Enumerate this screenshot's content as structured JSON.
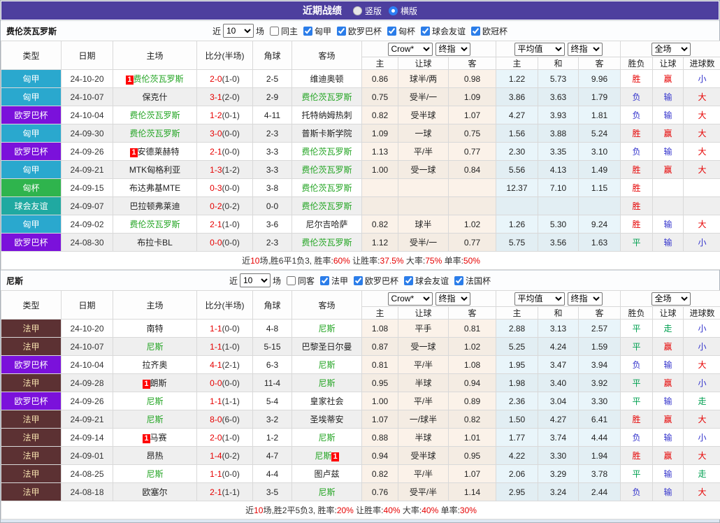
{
  "page": {
    "title": "近期战绩",
    "layout_options": [
      {
        "label": "竖版",
        "selected": false
      },
      {
        "label": "横版",
        "selected": true
      }
    ]
  },
  "table_header": {
    "type": "类型",
    "date": "日期",
    "home": "主场",
    "score": "比分(半场)",
    "corner": "角球",
    "away": "客场",
    "group1_select1": "Crow*",
    "group1_select2": "终指",
    "group2_select1": "平均值",
    "group2_select2": "终指",
    "group3_select1": "全场",
    "group1_cols": [
      "主",
      "让球",
      "客"
    ],
    "group2_cols": [
      "主",
      "和",
      "客"
    ],
    "group3_cols": [
      "胜负",
      "让球",
      "进球数"
    ]
  },
  "colors": {
    "accent": "#4D3F9E",
    "team_highlight": "#22A422",
    "score_red": "#E60000",
    "badge_bg": "#FF0000",
    "type_badges": {
      "匈甲": {
        "bg": "#2AA8CE",
        "fg": "#FFFFFF"
      },
      "欧罗巴杯": {
        "bg": "#7B11DB",
        "fg": "#FFFFFF"
      },
      "匈杯": {
        "bg": "#2FB44D",
        "fg": "#FFFFFF"
      },
      "球会友谊": {
        "bg": "#20A9A1",
        "fg": "#FFFFFF"
      },
      "法甲": {
        "bg": "#5C3133",
        "fg": "#F4DFAD"
      }
    },
    "result": {
      "胜": "#E60000",
      "平": "#00A050",
      "负": "#3333CC",
      "赢": "#E60000",
      "输": "#3333CC",
      "走": "#00A050",
      "大": "#E60000",
      "小": "#3333CC"
    }
  },
  "sections": [
    {
      "team": "费伦茨瓦罗斯",
      "filter": {
        "prefix": "近",
        "count": "10",
        "suffix": "场",
        "same": {
          "label": "同主",
          "checked": false
        },
        "leagues": [
          {
            "label": "匈甲",
            "checked": true
          },
          {
            "label": "欧罗巴杯",
            "checked": true
          },
          {
            "label": "匈杯",
            "checked": true
          },
          {
            "label": "球会友谊",
            "checked": true
          },
          {
            "label": "欧冠杯",
            "checked": true
          }
        ]
      },
      "rows": [
        {
          "type": "匈甲",
          "date": "24-10-20",
          "home": {
            "name": "费伦茨瓦罗斯",
            "green": true,
            "badge": "1"
          },
          "score": "2-0",
          "half": "(1-0)",
          "corner": "2-5",
          "away": {
            "name": "维迪奥顿"
          },
          "crown": [
            "0.86",
            "球半/两",
            "0.98"
          ],
          "avg": [
            "1.22",
            "5.73",
            "9.96"
          ],
          "result": [
            "胜",
            "赢",
            "小"
          ]
        },
        {
          "type": "匈甲",
          "date": "24-10-07",
          "home": {
            "name": "保克什"
          },
          "score": "3-1",
          "half": "(2-0)",
          "corner": "2-9",
          "away": {
            "name": "费伦茨瓦罗斯",
            "green": true
          },
          "crown": [
            "0.75",
            "受半/一",
            "1.09"
          ],
          "avg": [
            "3.86",
            "3.63",
            "1.79"
          ],
          "result": [
            "负",
            "输",
            "大"
          ]
        },
        {
          "type": "欧罗巴杯",
          "date": "24-10-04",
          "home": {
            "name": "费伦茨瓦罗斯",
            "green": true
          },
          "score": "1-2",
          "half": "(0-1)",
          "corner": "4-11",
          "away": {
            "name": "托特纳姆热刺"
          },
          "crown": [
            "0.82",
            "受半球",
            "1.07"
          ],
          "avg": [
            "4.27",
            "3.93",
            "1.81"
          ],
          "result": [
            "负",
            "输",
            "大"
          ]
        },
        {
          "type": "匈甲",
          "date": "24-09-30",
          "home": {
            "name": "费伦茨瓦罗斯",
            "green": true
          },
          "score": "3-0",
          "half": "(0-0)",
          "corner": "2-3",
          "away": {
            "name": "普斯卡斯学院"
          },
          "crown": [
            "1.09",
            "一球",
            "0.75"
          ],
          "avg": [
            "1.56",
            "3.88",
            "5.24"
          ],
          "result": [
            "胜",
            "赢",
            "大"
          ]
        },
        {
          "type": "欧罗巴杯",
          "date": "24-09-26",
          "home": {
            "name": "安德莱赫特",
            "badge": "1"
          },
          "score": "2-1",
          "half": "(0-0)",
          "corner": "3-3",
          "away": {
            "name": "费伦茨瓦罗斯",
            "green": true
          },
          "crown": [
            "1.13",
            "平/半",
            "0.77"
          ],
          "avg": [
            "2.30",
            "3.35",
            "3.10"
          ],
          "result": [
            "负",
            "输",
            "大"
          ]
        },
        {
          "type": "匈甲",
          "date": "24-09-21",
          "home": {
            "name": "MTK匈格利亚"
          },
          "score": "1-3",
          "half": "(1-2)",
          "corner": "3-3",
          "away": {
            "name": "费伦茨瓦罗斯",
            "green": true
          },
          "crown": [
            "1.00",
            "受一球",
            "0.84"
          ],
          "avg": [
            "5.56",
            "4.13",
            "1.49"
          ],
          "result": [
            "胜",
            "赢",
            "大"
          ]
        },
        {
          "type": "匈杯",
          "date": "24-09-15",
          "home": {
            "name": "布达弗基MTE"
          },
          "score": "0-3",
          "half": "(0-0)",
          "corner": "3-8",
          "away": {
            "name": "费伦茨瓦罗斯",
            "green": true
          },
          "crown": [
            "",
            "",
            ""
          ],
          "avg": [
            "12.37",
            "7.10",
            "1.15"
          ],
          "result": [
            "胜",
            "",
            ""
          ]
        },
        {
          "type": "球会友谊",
          "date": "24-09-07",
          "home": {
            "name": "巴拉顿弗莱迪"
          },
          "score": "0-2",
          "half": "(0-2)",
          "corner": "0-0",
          "away": {
            "name": "费伦茨瓦罗斯",
            "green": true
          },
          "crown": [
            "",
            "",
            ""
          ],
          "avg": [
            "",
            "",
            ""
          ],
          "result": [
            "胜",
            "",
            ""
          ]
        },
        {
          "type": "匈甲",
          "date": "24-09-02",
          "home": {
            "name": "费伦茨瓦罗斯",
            "green": true
          },
          "score": "2-1",
          "half": "(1-0)",
          "corner": "3-6",
          "away": {
            "name": "尼尔吉哈萨"
          },
          "crown": [
            "0.82",
            "球半",
            "1.02"
          ],
          "avg": [
            "1.26",
            "5.30",
            "9.24"
          ],
          "result": [
            "胜",
            "输",
            "大"
          ]
        },
        {
          "type": "欧罗巴杯",
          "date": "24-08-30",
          "home": {
            "name": "布拉卡BL"
          },
          "score": "0-0",
          "half": "(0-0)",
          "corner": "2-3",
          "away": {
            "name": "费伦茨瓦罗斯",
            "green": true
          },
          "crown": [
            "1.12",
            "受半/一",
            "0.77"
          ],
          "avg": [
            "5.75",
            "3.56",
            "1.63"
          ],
          "result": [
            "平",
            "输",
            "小"
          ]
        }
      ],
      "summary": [
        [
          "近",
          false
        ],
        [
          "10",
          true
        ],
        [
          "场,胜6平1负3, 胜率:",
          false
        ],
        [
          "60%",
          true
        ],
        [
          " 让胜率:",
          false
        ],
        [
          "37.5%",
          true
        ],
        [
          " 大率:",
          false
        ],
        [
          "75%",
          true
        ],
        [
          " 单率:",
          false
        ],
        [
          "50%",
          true
        ]
      ]
    },
    {
      "team": "尼斯",
      "filter": {
        "prefix": "近",
        "count": "10",
        "suffix": "场",
        "same": {
          "label": "同客",
          "checked": false
        },
        "leagues": [
          {
            "label": "法甲",
            "checked": true
          },
          {
            "label": "欧罗巴杯",
            "checked": true
          },
          {
            "label": "球会友谊",
            "checked": true
          },
          {
            "label": "法国杯",
            "checked": true
          }
        ]
      },
      "rows": [
        {
          "type": "法甲",
          "date": "24-10-20",
          "home": {
            "name": "南特"
          },
          "score": "1-1",
          "half": "(0-0)",
          "corner": "4-8",
          "away": {
            "name": "尼斯",
            "green": true
          },
          "crown": [
            "1.08",
            "平手",
            "0.81"
          ],
          "avg": [
            "2.88",
            "3.13",
            "2.57"
          ],
          "result": [
            "平",
            "走",
            "小"
          ]
        },
        {
          "type": "法甲",
          "date": "24-10-07",
          "home": {
            "name": "尼斯",
            "green": true
          },
          "score": "1-1",
          "half": "(1-0)",
          "corner": "5-15",
          "away": {
            "name": "巴黎圣日尔曼"
          },
          "crown": [
            "0.87",
            "受一球",
            "1.02"
          ],
          "avg": [
            "5.25",
            "4.24",
            "1.59"
          ],
          "result": [
            "平",
            "赢",
            "小"
          ]
        },
        {
          "type": "欧罗巴杯",
          "date": "24-10-04",
          "home": {
            "name": "拉齐奥"
          },
          "score": "4-1",
          "half": "(2-1)",
          "corner": "6-3",
          "away": {
            "name": "尼斯",
            "green": true
          },
          "crown": [
            "0.81",
            "平/半",
            "1.08"
          ],
          "avg": [
            "1.95",
            "3.47",
            "3.94"
          ],
          "result": [
            "负",
            "输",
            "大"
          ]
        },
        {
          "type": "法甲",
          "date": "24-09-28",
          "home": {
            "name": "朗斯",
            "badge": "1"
          },
          "score": "0-0",
          "half": "(0-0)",
          "corner": "11-4",
          "away": {
            "name": "尼斯",
            "green": true
          },
          "crown": [
            "0.95",
            "半球",
            "0.94"
          ],
          "avg": [
            "1.98",
            "3.40",
            "3.92"
          ],
          "result": [
            "平",
            "赢",
            "小"
          ]
        },
        {
          "type": "欧罗巴杯",
          "date": "24-09-26",
          "home": {
            "name": "尼斯",
            "green": true
          },
          "score": "1-1",
          "half": "(1-1)",
          "corner": "5-4",
          "away": {
            "name": "皇家社会"
          },
          "crown": [
            "1.00",
            "平/半",
            "0.89"
          ],
          "avg": [
            "2.36",
            "3.04",
            "3.30"
          ],
          "result": [
            "平",
            "输",
            "走"
          ]
        },
        {
          "type": "法甲",
          "date": "24-09-21",
          "home": {
            "name": "尼斯",
            "green": true
          },
          "score": "8-0",
          "half": "(6-0)",
          "corner": "3-2",
          "away": {
            "name": "圣埃蒂安"
          },
          "crown": [
            "1.07",
            "一/球半",
            "0.82"
          ],
          "avg": [
            "1.50",
            "4.27",
            "6.41"
          ],
          "result": [
            "胜",
            "赢",
            "大"
          ]
        },
        {
          "type": "法甲",
          "date": "24-09-14",
          "home": {
            "name": "马赛",
            "badge": "1"
          },
          "score": "2-0",
          "half": "(1-0)",
          "corner": "1-2",
          "away": {
            "name": "尼斯",
            "green": true
          },
          "crown": [
            "0.88",
            "半球",
            "1.01"
          ],
          "avg": [
            "1.77",
            "3.74",
            "4.44"
          ],
          "result": [
            "负",
            "输",
            "小"
          ]
        },
        {
          "type": "法甲",
          "date": "24-09-01",
          "home": {
            "name": "昂热"
          },
          "score": "1-4",
          "half": "(0-2)",
          "corner": "4-7",
          "away": {
            "name": "尼斯",
            "green": true,
            "badgeAfter": "1"
          },
          "crown": [
            "0.94",
            "受半球",
            "0.95"
          ],
          "avg": [
            "4.22",
            "3.30",
            "1.94"
          ],
          "result": [
            "胜",
            "赢",
            "大"
          ]
        },
        {
          "type": "法甲",
          "date": "24-08-25",
          "home": {
            "name": "尼斯",
            "green": true
          },
          "score": "1-1",
          "half": "(0-0)",
          "corner": "4-4",
          "away": {
            "name": "图卢兹"
          },
          "crown": [
            "0.82",
            "平/半",
            "1.07"
          ],
          "avg": [
            "2.06",
            "3.29",
            "3.78"
          ],
          "result": [
            "平",
            "输",
            "走"
          ]
        },
        {
          "type": "法甲",
          "date": "24-08-18",
          "home": {
            "name": "欧塞尔"
          },
          "score": "2-1",
          "half": "(1-1)",
          "corner": "3-5",
          "away": {
            "name": "尼斯",
            "green": true
          },
          "crown": [
            "0.76",
            "受平/半",
            "1.14"
          ],
          "avg": [
            "2.95",
            "3.24",
            "2.44"
          ],
          "result": [
            "负",
            "输",
            "大"
          ]
        }
      ],
      "summary": [
        [
          "近",
          false
        ],
        [
          "10",
          true
        ],
        [
          "场,胜2平5负3, 胜率:",
          false
        ],
        [
          "20%",
          true
        ],
        [
          " 让胜率:",
          false
        ],
        [
          "40%",
          true
        ],
        [
          " 大率:",
          false
        ],
        [
          "40%",
          true
        ],
        [
          " 单率:",
          false
        ],
        [
          "30%",
          true
        ]
      ]
    }
  ]
}
